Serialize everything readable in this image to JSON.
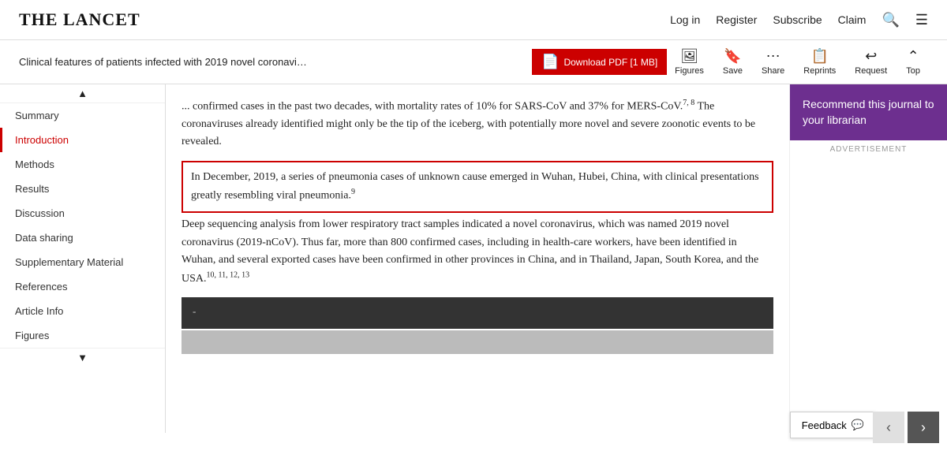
{
  "header": {
    "logo": "THE LANCET",
    "nav": {
      "login": "Log in",
      "register": "Register",
      "subscribe": "Subscribe",
      "claim": "Claim"
    }
  },
  "toolbar": {
    "article_title": "Clinical features of patients infected with 2019 novel coronavi…",
    "pdf_button": "Download PDF [1 MB]",
    "actions": [
      {
        "id": "figures",
        "label": "Figures",
        "icon": "🖼"
      },
      {
        "id": "save",
        "label": "Save",
        "icon": "🔖"
      },
      {
        "id": "share",
        "label": "Share",
        "icon": "⋯"
      },
      {
        "id": "reprints",
        "label": "Reprints",
        "icon": "📋"
      },
      {
        "id": "request",
        "label": "Request",
        "icon": "↩"
      },
      {
        "id": "top",
        "label": "Top",
        "icon": "⌃"
      }
    ]
  },
  "sidebar": {
    "scroll_up": "▲",
    "scroll_down": "▼",
    "items": [
      {
        "id": "summary",
        "label": "Summary",
        "active": false
      },
      {
        "id": "introduction",
        "label": "Introduction",
        "active": true
      },
      {
        "id": "methods",
        "label": "Methods",
        "active": false
      },
      {
        "id": "results",
        "label": "Results",
        "active": false
      },
      {
        "id": "discussion",
        "label": "Discussion",
        "active": false
      },
      {
        "id": "data-sharing",
        "label": "Data sharing",
        "active": false
      },
      {
        "id": "supplementary",
        "label": "Supplementary Material",
        "active": false
      },
      {
        "id": "references",
        "label": "References",
        "active": false
      },
      {
        "id": "article-info",
        "label": "Article Info",
        "active": false
      },
      {
        "id": "figures",
        "label": "Figures",
        "active": false
      }
    ]
  },
  "content": {
    "paragraph1": "... confirmed cases in the past two decades, with mortality rates of 10% for SARS-CoV and 37% for MERS-CoV.",
    "footnotes1": "7, 8",
    "paragraph1b": " The coronaviruses already identified might only be the tip of the iceberg, with potentially more novel and severe zoonotic events to be revealed.",
    "highlighted": "In December, 2019, a series of pneumonia cases of unknown cause emerged in Wuhan, Hubei, China, with clinical presentations greatly resembling viral pneumonia.",
    "footnote_highlighted": "9",
    "paragraph2": " Deep sequencing analysis from lower respiratory tract samples indicated a novel coronavirus, which was named 2019 novel coronavirus (2019-nCoV). Thus far, more than 800 confirmed cases, including in health-care workers, have been identified in Wuhan, and several exported cases have been confirmed in other provinces in China, and in Thailand, Japan, South Korea, and the USA.",
    "footnotes2": "10, 11, 12, 13",
    "dark_block_text": "-"
  },
  "right_panel": {
    "recommend_text": "Recommend this journal to your librarian",
    "advertisement_label": "ADVERTISEMENT"
  },
  "feedback": {
    "label": "Feedback",
    "icon": "💬"
  },
  "nav_arrows": {
    "prev": "‹",
    "next": "›"
  }
}
